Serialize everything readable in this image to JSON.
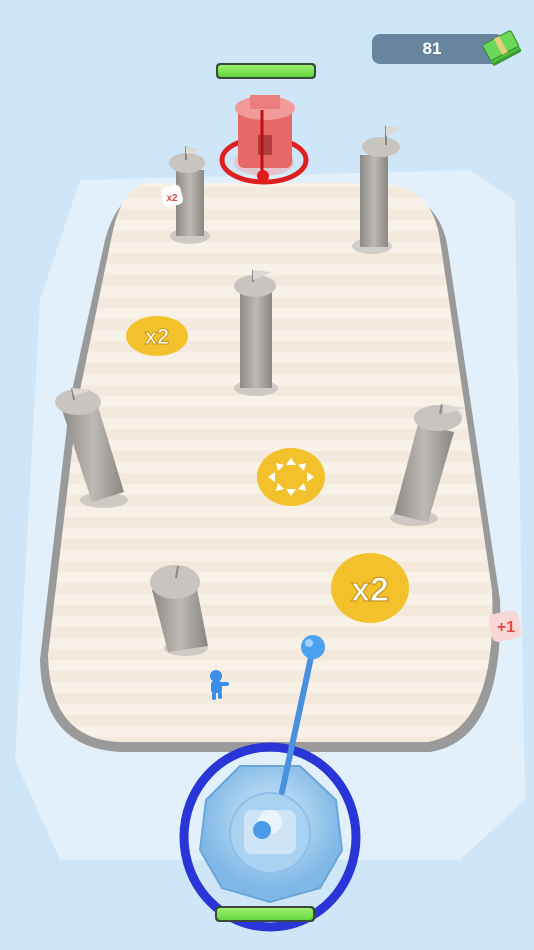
{
  "hud": {
    "money": "81",
    "money_icon": "cash-stack-icon"
  },
  "enemy_base": {
    "health_fraction": 1.0,
    "icon": "enemy-castle-icon"
  },
  "player_base": {
    "health_fraction": 1.0,
    "icon": "player-castle-icon"
  },
  "pads": {
    "multiplier_left": "x2",
    "multiplier_right": "x2",
    "spread_icon": "arrows-outward-icon"
  },
  "side_bonus": {
    "left": "x2",
    "right": "+1"
  },
  "colors": {
    "water": "#cfe6f8",
    "board": "#f7f0e6",
    "enemy": "#e94a4a",
    "player": "#4a9ae8",
    "ring": "#2a35d8",
    "pad": "#f2c12c"
  }
}
